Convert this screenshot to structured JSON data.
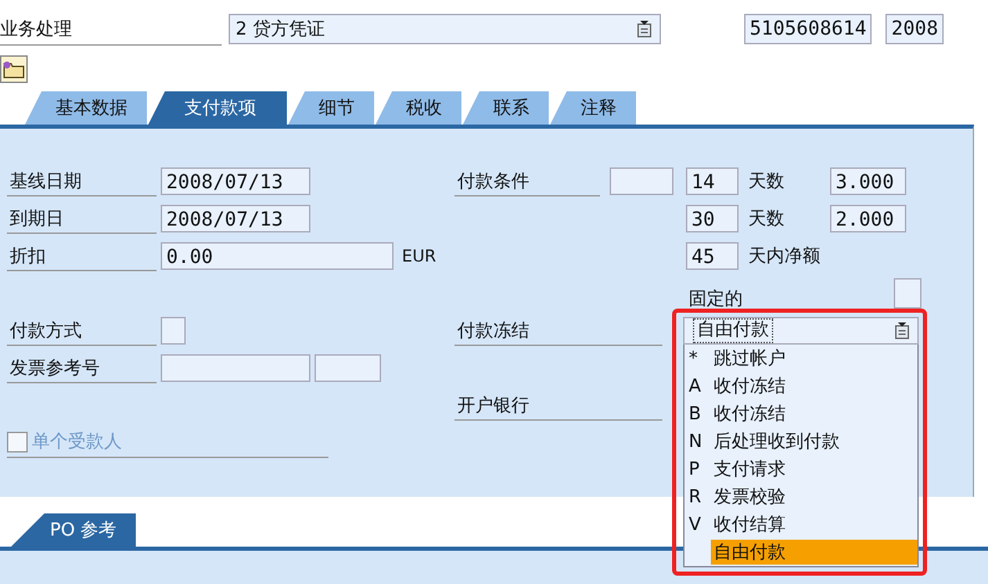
{
  "header": {
    "label": "业务处理",
    "document_type": {
      "value": "2 贷方凭证"
    },
    "document_number": "5105608614",
    "fiscal_year": "2008"
  },
  "tabs": [
    {
      "label": "基本数据",
      "selected": false
    },
    {
      "label": "支付款项",
      "selected": true
    },
    {
      "label": "细节",
      "selected": false
    },
    {
      "label": "税收",
      "selected": false
    },
    {
      "label": "联系",
      "selected": false
    },
    {
      "label": "注释",
      "selected": false
    }
  ],
  "left": [
    {
      "kind": "date",
      "label": "基线日期",
      "value": "2008/07/13"
    },
    {
      "kind": "date",
      "label": "到期日",
      "value": "2008/07/13"
    },
    {
      "kind": "amount",
      "label": "折扣",
      "value": "0.00",
      "unit": "EUR"
    },
    {
      "kind": "code",
      "label": "付款方式"
    },
    {
      "kind": "reference",
      "label": "发票参考号"
    },
    {
      "kind": "checkbox",
      "label": "单个受款人",
      "checked": false
    }
  ],
  "right": [
    {
      "kind": "terms",
      "label": "付款条件",
      "lines": [
        {
          "days": "14",
          "unit": "天数",
          "percent": "3.000"
        },
        {
          "days": "30",
          "unit": "天数",
          "percent": "2.000"
        },
        {
          "days": "45",
          "unit": "天内净额"
        }
      ]
    },
    {
      "kind": "fixed",
      "label": "固定的",
      "checked": false
    },
    {
      "kind": "block",
      "label": "付款冻结",
      "value": "自由付款",
      "expanded": true,
      "options": [
        {
          "code": "*",
          "text": "跳过帐户",
          "selected": false
        },
        {
          "code": "A",
          "text": "收付冻结",
          "selected": false
        },
        {
          "code": "B",
          "text": "收付冻结",
          "selected": false
        },
        {
          "code": "N",
          "text": "后处理收到付款",
          "selected": false
        },
        {
          "code": "P",
          "text": "支付请求",
          "selected": false
        },
        {
          "code": "R",
          "text": "发票校验",
          "selected": false
        },
        {
          "code": "V",
          "text": "收付结算",
          "selected": false
        },
        {
          "text": "自由付款",
          "selected": true
        }
      ]
    },
    {
      "kind": "bank",
      "label": "开户银行"
    }
  ],
  "lower_tabs": [
    {
      "label": "PO 参考",
      "selected": true
    }
  ]
}
